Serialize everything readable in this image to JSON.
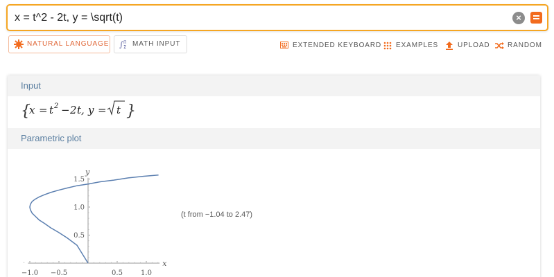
{
  "search": {
    "value": "x = t^2 - 2t, y = \\sqrt(t)"
  },
  "modes": {
    "natural_language": "Natural Language",
    "math_input": "Math Input"
  },
  "tools": {
    "extended_keyboard": "Extended Keyboard",
    "examples": "Examples",
    "upload": "Upload",
    "random": "Random"
  },
  "pods": {
    "input_title": "Input",
    "parametric_title": "Parametric plot",
    "range_note": "(t from −1.04 to 2.47)"
  },
  "colors": {
    "accent": "#f26b1d",
    "search_border": "#f5a623",
    "curve": "#5b7fb0",
    "pod_title": "#5a7ea0"
  },
  "chart_data": {
    "type": "line",
    "parametric": "x = t^2 - 2t, y = sqrt(t)",
    "t_range": [
      -1.04,
      2.47
    ],
    "xlabel": "x",
    "ylabel": "y",
    "xlim": [
      -1.15,
      1.3
    ],
    "ylim": [
      0,
      1.62
    ],
    "x_ticks": [
      -1.0,
      -0.5,
      0.5,
      1.0
    ],
    "x_tick_labels": [
      "−1.0",
      "−0.5",
      "0.5",
      "1.0"
    ],
    "y_ticks": [
      0.5,
      1.0,
      1.5
    ],
    "y_tick_labels": [
      "0.5",
      "1.0",
      "1.5"
    ],
    "series": [
      {
        "x": [
          0.0,
          -0.19,
          -0.36,
          -0.51,
          -0.64,
          -0.75,
          -0.84,
          -0.91,
          -0.96,
          -0.99,
          -1.0,
          -0.99,
          -0.96,
          -0.91,
          -0.84,
          -0.75,
          -0.64,
          -0.51,
          -0.36,
          -0.19,
          0.0,
          0.21,
          0.44,
          0.69,
          0.96,
          1.21
        ],
        "y": [
          0.0,
          0.32,
          0.45,
          0.55,
          0.63,
          0.71,
          0.77,
          0.84,
          0.89,
          0.95,
          1.0,
          1.05,
          1.1,
          1.14,
          1.18,
          1.22,
          1.26,
          1.3,
          1.34,
          1.38,
          1.41,
          1.45,
          1.48,
          1.52,
          1.55,
          1.57
        ]
      }
    ]
  }
}
